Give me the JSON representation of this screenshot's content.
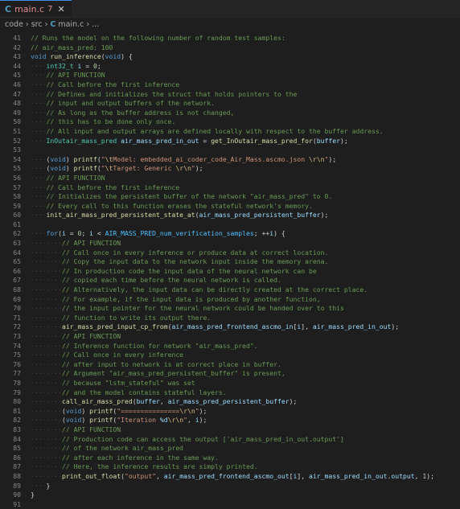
{
  "tab": {
    "filename": "main.c",
    "problems": "7",
    "close": "✕",
    "lang_icon": "C"
  },
  "breadcrumb": [
    "code",
    "src",
    "main.c",
    "..."
  ],
  "lines": [
    {
      "n": "41",
      "i": 0,
      "t": [
        [
          "cmt",
          "// Runs the model on the following number of random test samples:"
        ]
      ]
    },
    {
      "n": "42",
      "i": 0,
      "t": [
        [
          "cmt",
          "// air_mass_pred: 100"
        ]
      ]
    },
    {
      "n": "43",
      "i": 0,
      "t": [
        [
          "kw",
          "void"
        ],
        [
          "p",
          " "
        ],
        [
          "fn",
          "run_inference"
        ],
        [
          "p",
          "("
        ],
        [
          "kw",
          "void"
        ],
        [
          "p",
          ") {"
        ]
      ]
    },
    {
      "n": "44",
      "i": 1,
      "t": [
        [
          "ty",
          "int32_t"
        ],
        [
          "p",
          " "
        ],
        [
          "var",
          "i"
        ],
        [
          "p",
          " = "
        ],
        [
          "num",
          "0"
        ],
        [
          "p",
          ";"
        ]
      ]
    },
    {
      "n": "45",
      "i": 1,
      "t": [
        [
          "cmt",
          "// API FUNCTION"
        ]
      ]
    },
    {
      "n": "46",
      "i": 1,
      "t": [
        [
          "cmt",
          "// Call before the first inference"
        ]
      ]
    },
    {
      "n": "47",
      "i": 1,
      "t": [
        [
          "cmt",
          "// Defines and initializes the struct that holds pointers to the"
        ]
      ]
    },
    {
      "n": "48",
      "i": 1,
      "t": [
        [
          "cmt",
          "// input and output buffers of the network."
        ]
      ]
    },
    {
      "n": "49",
      "i": 1,
      "t": [
        [
          "cmt",
          "// As long as the buffer address is not changed,"
        ]
      ]
    },
    {
      "n": "50",
      "i": 1,
      "t": [
        [
          "cmt",
          "// this has to be done only once."
        ]
      ]
    },
    {
      "n": "51",
      "i": 1,
      "t": [
        [
          "cmt",
          "// All input and output arrays are defined locally with respect to the buffer address."
        ]
      ]
    },
    {
      "n": "52",
      "i": 1,
      "t": [
        [
          "ty",
          "InOutair_mass_pred"
        ],
        [
          "p",
          " "
        ],
        [
          "var",
          "air_mass_pred_in_out"
        ],
        [
          "p",
          " = "
        ],
        [
          "fn",
          "get_InOutair_mass_pred_for"
        ],
        [
          "p",
          "("
        ],
        [
          "var",
          "buffer"
        ],
        [
          "p",
          ");"
        ]
      ]
    },
    {
      "n": "53",
      "i": 0,
      "t": []
    },
    {
      "n": "54",
      "i": 1,
      "t": [
        [
          "p",
          "("
        ],
        [
          "kw",
          "void"
        ],
        [
          "p",
          ") "
        ],
        [
          "fn",
          "printf"
        ],
        [
          "p",
          "("
        ],
        [
          "str",
          "\""
        ],
        [
          "esc",
          "\\t"
        ],
        [
          "str",
          "Model: embedded_ai_coder_code_Air_Mass.ascmo.json "
        ],
        [
          "esc",
          "\\r\\n"
        ],
        [
          "str",
          "\""
        ],
        [
          "p",
          ");"
        ]
      ]
    },
    {
      "n": "55",
      "i": 1,
      "t": [
        [
          "p",
          "("
        ],
        [
          "kw",
          "void"
        ],
        [
          "p",
          ") "
        ],
        [
          "fn",
          "printf"
        ],
        [
          "p",
          "("
        ],
        [
          "str",
          "\""
        ],
        [
          "esc",
          "\\t"
        ],
        [
          "str",
          "Target: Generic "
        ],
        [
          "esc",
          "\\r\\n"
        ],
        [
          "str",
          "\""
        ],
        [
          "p",
          ");"
        ]
      ]
    },
    {
      "n": "56",
      "i": 1,
      "t": [
        [
          "cmt",
          "// API FUNCTION"
        ]
      ]
    },
    {
      "n": "57",
      "i": 1,
      "t": [
        [
          "cmt",
          "// Call before the first inference"
        ]
      ]
    },
    {
      "n": "58",
      "i": 1,
      "t": [
        [
          "cmt",
          "// Initializes the persistent buffer of the network \"air_mass_pred\" to 0."
        ]
      ]
    },
    {
      "n": "59",
      "i": 1,
      "t": [
        [
          "cmt",
          "// Every call to this function erases the stateful network's memory."
        ]
      ]
    },
    {
      "n": "60",
      "i": 1,
      "t": [
        [
          "fn",
          "init_air_mass_pred_persistent_state_at"
        ],
        [
          "p",
          "("
        ],
        [
          "var",
          "air_mass_pred_persistent_buffer"
        ],
        [
          "p",
          ");"
        ]
      ]
    },
    {
      "n": "61",
      "i": 0,
      "t": []
    },
    {
      "n": "62",
      "i": 1,
      "t": [
        [
          "kw",
          "for"
        ],
        [
          "p",
          "("
        ],
        [
          "var",
          "i"
        ],
        [
          "p",
          " = "
        ],
        [
          "num",
          "0"
        ],
        [
          "p",
          "; "
        ],
        [
          "var",
          "i"
        ],
        [
          "p",
          " < "
        ],
        [
          "mac",
          "AIR_MASS_PRED_num_verification_samples"
        ],
        [
          "p",
          "; ++"
        ],
        [
          "var",
          "i"
        ],
        [
          "p",
          ") {"
        ]
      ]
    },
    {
      "n": "63",
      "i": 2,
      "t": [
        [
          "cmt",
          "// API FUNCTION"
        ]
      ]
    },
    {
      "n": "64",
      "i": 2,
      "t": [
        [
          "cmt",
          "// Call once in every inference or produce data at correct location."
        ]
      ]
    },
    {
      "n": "65",
      "i": 2,
      "t": [
        [
          "cmt",
          "// Copy the input data to the network input inside the memory arena."
        ]
      ]
    },
    {
      "n": "66",
      "i": 2,
      "t": [
        [
          "cmt",
          "// In production code the input data of the neural network can be"
        ]
      ]
    },
    {
      "n": "67",
      "i": 2,
      "t": [
        [
          "cmt",
          "// copied each time before the neural network is called."
        ]
      ]
    },
    {
      "n": "68",
      "i": 2,
      "t": [
        [
          "cmt",
          "// Alternatively, the input data can be directly created at the correct place."
        ]
      ]
    },
    {
      "n": "69",
      "i": 2,
      "t": [
        [
          "cmt",
          "// For example, if the input data is produced by another function,"
        ]
      ]
    },
    {
      "n": "70",
      "i": 2,
      "t": [
        [
          "cmt",
          "// the input pointer for the neural network could be handed over to this"
        ]
      ]
    },
    {
      "n": "71",
      "i": 2,
      "t": [
        [
          "cmt",
          "// function to write its output there."
        ]
      ]
    },
    {
      "n": "72",
      "i": 2,
      "t": [
        [
          "fn",
          "air_mass_pred_input_cp_from"
        ],
        [
          "p",
          "("
        ],
        [
          "var",
          "air_mass_pred_frontend_ascmo_in"
        ],
        [
          "p",
          "["
        ],
        [
          "var",
          "i"
        ],
        [
          "p",
          "], "
        ],
        [
          "var",
          "air_mass_pred_in_out"
        ],
        [
          "p",
          ");"
        ]
      ]
    },
    {
      "n": "73",
      "i": 2,
      "t": [
        [
          "cmt",
          "// API FUNCTION"
        ]
      ]
    },
    {
      "n": "74",
      "i": 2,
      "t": [
        [
          "cmt",
          "// Inference function for network \"air_mass_pred\"."
        ]
      ]
    },
    {
      "n": "75",
      "i": 2,
      "t": [
        [
          "cmt",
          "// Call once in every inference"
        ]
      ]
    },
    {
      "n": "76",
      "i": 2,
      "t": [
        [
          "cmt",
          "// after input to network is at correct place in buffer."
        ]
      ]
    },
    {
      "n": "77",
      "i": 2,
      "t": [
        [
          "cmt",
          "// Argument \"air_mass_pred_persistent_buffer\" is present,"
        ]
      ]
    },
    {
      "n": "78",
      "i": 2,
      "t": [
        [
          "cmt",
          "// because \"lstm_stateful\" was set"
        ]
      ]
    },
    {
      "n": "79",
      "i": 2,
      "t": [
        [
          "cmt",
          "// and the model contains stateful layers."
        ]
      ]
    },
    {
      "n": "80",
      "i": 2,
      "t": [
        [
          "fn",
          "call_air_mass_pred"
        ],
        [
          "p",
          "("
        ],
        [
          "var",
          "buffer"
        ],
        [
          "p",
          ", "
        ],
        [
          "var",
          "air_mass_pred_persistent_buffer"
        ],
        [
          "p",
          ");"
        ]
      ]
    },
    {
      "n": "81",
      "i": 2,
      "t": [
        [
          "p",
          "("
        ],
        [
          "kw",
          "void"
        ],
        [
          "p",
          ") "
        ],
        [
          "fn",
          "printf"
        ],
        [
          "p",
          "("
        ],
        [
          "str",
          "\"==============="
        ],
        [
          "esc",
          "\\r\\n"
        ],
        [
          "str",
          "\""
        ],
        [
          "p",
          ");"
        ]
      ]
    },
    {
      "n": "82",
      "i": 2,
      "t": [
        [
          "p",
          "("
        ],
        [
          "kw",
          "void"
        ],
        [
          "p",
          ") "
        ],
        [
          "fn",
          "printf"
        ],
        [
          "p",
          "("
        ],
        [
          "str",
          "\"Iteration "
        ],
        [
          "var",
          "%d"
        ],
        [
          "esc",
          "\\r\\n"
        ],
        [
          "str",
          "\""
        ],
        [
          "p",
          ", "
        ],
        [
          "var",
          "i"
        ],
        [
          "p",
          ");"
        ]
      ]
    },
    {
      "n": "83",
      "i": 2,
      "t": [
        [
          "cmt",
          "// API FUNCTION"
        ]
      ]
    },
    {
      "n": "84",
      "i": 2,
      "t": [
        [
          "cmt",
          "// Production code can access the output ['air_mass_pred_in_out.output']"
        ]
      ]
    },
    {
      "n": "85",
      "i": 2,
      "t": [
        [
          "cmt",
          "// of the network air_mass_pred"
        ]
      ]
    },
    {
      "n": "86",
      "i": 2,
      "t": [
        [
          "cmt",
          "// after each inference in the same way."
        ]
      ]
    },
    {
      "n": "87",
      "i": 2,
      "t": [
        [
          "cmt",
          "// Here, the inference results are simply printed."
        ]
      ]
    },
    {
      "n": "88",
      "i": 2,
      "t": [
        [
          "fn",
          "print_out_float"
        ],
        [
          "p",
          "("
        ],
        [
          "str",
          "\"output\""
        ],
        [
          "p",
          ", "
        ],
        [
          "var",
          "air_mass_pred_frontend_ascmo_out"
        ],
        [
          "p",
          "["
        ],
        [
          "var",
          "i"
        ],
        [
          "p",
          "], "
        ],
        [
          "var",
          "air_mass_pred_in_out"
        ],
        [
          "p",
          "."
        ],
        [
          "var",
          "output"
        ],
        [
          "p",
          ", "
        ],
        [
          "num",
          "1"
        ],
        [
          "p",
          ");"
        ]
      ]
    },
    {
      "n": "89",
      "i": 1,
      "t": [
        [
          "p",
          "}"
        ]
      ]
    },
    {
      "n": "90",
      "i": 0,
      "t": [
        [
          "p",
          "}"
        ]
      ]
    },
    {
      "n": "91",
      "i": 0,
      "t": []
    }
  ]
}
